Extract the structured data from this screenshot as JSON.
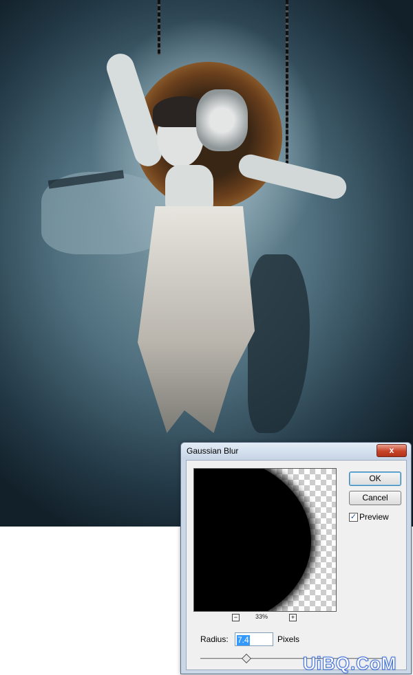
{
  "dialog": {
    "title": "Gaussian Blur",
    "close_glyph": "x",
    "ok_label": "OK",
    "cancel_label": "Cancel",
    "preview_label": "Preview",
    "preview_checked": true,
    "zoom_out_glyph": "−",
    "zoom_in_glyph": "+",
    "zoom_level": "33%",
    "radius_label": "Radius:",
    "radius_value": "7.4",
    "radius_unit": "Pixels",
    "close_color": "#c7442a"
  },
  "watermark": {
    "text": "UiBQ.CoM"
  },
  "icons": {
    "close": "close-icon",
    "zoom_out": "zoom-out-icon",
    "zoom_in": "zoom-in-icon",
    "check": "checkmark-icon"
  }
}
